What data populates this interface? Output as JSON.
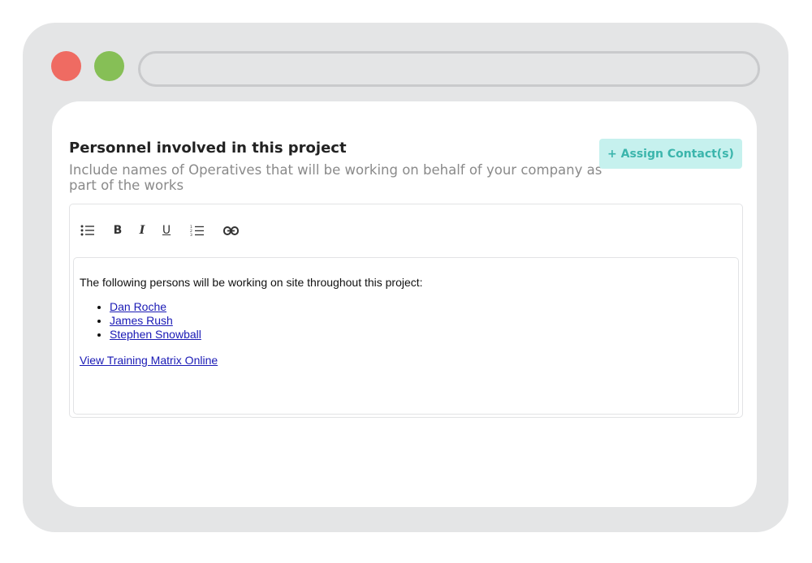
{
  "section": {
    "title": "Personnel involved in this project",
    "subtitle": "Include names of Operatives that will be working on behalf of your company as part of the works",
    "assign_button": "+ Assign Contact(s)"
  },
  "toolbar": {
    "bold": "B",
    "italic": "I",
    "underline": "U",
    "icons": [
      "bulleted-list-icon",
      "bold-icon",
      "italic-icon",
      "underline-icon",
      "numbered-list-icon",
      "link-icon"
    ]
  },
  "editor": {
    "intro": "The following persons will be working on site throughout this project:",
    "people": [
      "Dan Roche",
      "James Rush",
      "Stephen Snowball"
    ],
    "matrix_link": "View Training Matrix Online"
  },
  "colors": {
    "window_frame": "#e4e5e6",
    "close_dot": "#ef6b62",
    "maximize_dot": "#86bf56",
    "button_bg": "#c6f1ee",
    "button_text": "#3bb5ac",
    "link": "#1a1ab5"
  }
}
